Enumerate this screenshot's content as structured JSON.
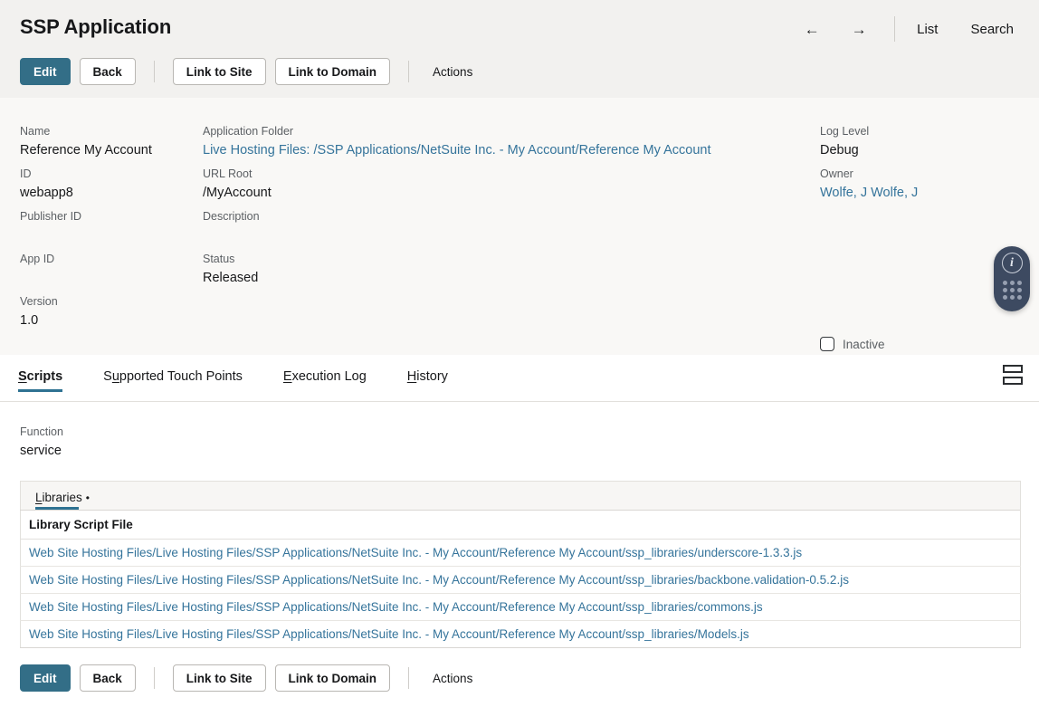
{
  "header": {
    "title": "SSP Application",
    "nav": {
      "back_arrow": "←",
      "forward_arrow": "→",
      "list_label": "List",
      "search_label": "Search"
    }
  },
  "toolbar": {
    "edit_label": "Edit",
    "back_label": "Back",
    "link_to_site_label": "Link to Site",
    "link_to_domain_label": "Link to Domain",
    "actions_label": "Actions"
  },
  "fields": {
    "name_label": "Name",
    "name_value": "Reference My Account",
    "id_label": "ID",
    "id_value": "webapp8",
    "publisher_id_label": "Publisher ID",
    "publisher_id_value": "",
    "app_id_label": "App ID",
    "app_id_value": "",
    "version_label": "Version",
    "version_value": "1.0",
    "application_folder_label": "Application Folder",
    "application_folder_value": "Live Hosting Files: /SSP Applications/NetSuite Inc. - My Account/Reference My Account",
    "url_root_label": "URL Root",
    "url_root_value": "/MyAccount",
    "description_label": "Description",
    "description_value": "",
    "status_label": "Status",
    "status_value": "Released",
    "log_level_label": "Log Level",
    "log_level_value": "Debug",
    "owner_label": "Owner",
    "owner_value": "Wolfe, J Wolfe, J",
    "inactive_label": "Inactive",
    "inactive_checked": false
  },
  "info_widget": {
    "icon": "info-circle-icon",
    "grid_icon": "dot-grid-icon"
  },
  "tabs": [
    {
      "prefix": "",
      "accesskey": "S",
      "suffix": "cripts",
      "label": "Scripts",
      "active": true
    },
    {
      "prefix": "S",
      "accesskey": "u",
      "suffix": "pported Touch Points",
      "label": "Supported Touch Points",
      "active": false
    },
    {
      "prefix": "",
      "accesskey": "E",
      "suffix": "xecution Log",
      "label": "Execution Log",
      "active": false
    },
    {
      "prefix": "",
      "accesskey": "H",
      "suffix": "istory",
      "label": "History",
      "active": false
    }
  ],
  "view_toggle": {
    "icon": "rows-view-icon"
  },
  "scripts_tab": {
    "function_label": "Function",
    "function_value": "service",
    "sublist": {
      "tab_accesskey": "L",
      "tab_suffix": "ibraries",
      "tab_label": "Libraries",
      "tab_bullet": "•",
      "column_header": "Library Script File",
      "rows": [
        "Web Site Hosting Files/Live Hosting Files/SSP Applications/NetSuite Inc. - My Account/Reference My Account/ssp_libraries/underscore-1.3.3.js",
        "Web Site Hosting Files/Live Hosting Files/SSP Applications/NetSuite Inc. - My Account/Reference My Account/ssp_libraries/backbone.validation-0.5.2.js",
        "Web Site Hosting Files/Live Hosting Files/SSP Applications/NetSuite Inc. - My Account/Reference My Account/ssp_libraries/commons.js",
        "Web Site Hosting Files/Live Hosting Files/SSP Applications/NetSuite Inc. - My Account/Reference My Account/ssp_libraries/Models.js"
      ]
    }
  },
  "colors": {
    "primary_button": "#336e87",
    "active_tab_underline": "#2e7292",
    "link": "#35749b",
    "header_strip_bg": "#f2f1ef",
    "field_area_bg": "#f9f8f6",
    "info_widget_bg": "#3d4a61"
  }
}
